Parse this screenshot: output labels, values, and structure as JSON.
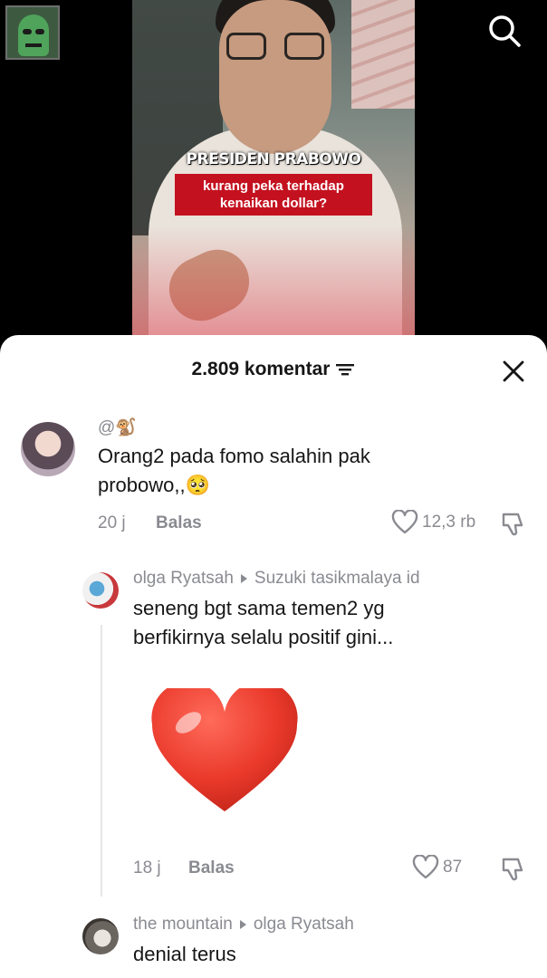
{
  "video": {
    "caption_title": "PRESIDEN PRABOWO",
    "caption_box": "kurang peka terhadap kenaikan dollar?",
    "search_icon": "search-icon"
  },
  "comments_panel": {
    "count_label": "2.809 komentar",
    "filter_icon": "filter-icon",
    "close_icon": "close-icon"
  },
  "comments": [
    {
      "username": "@🐒",
      "text": "Orang2 pada fomo salahin pak probowo,,🥺",
      "time": "20 j",
      "reply_label": "Balas",
      "likes": "12,3 rb"
    },
    {
      "username": "olga Ryatsah",
      "reply_to": "Suzuki tasikmalaya id",
      "text": "seneng bgt sama temen2 yg berfikirnya selalu positif gini...",
      "sticker": "❤️",
      "time": "18 j",
      "reply_label": "Balas",
      "likes": "87"
    },
    {
      "username": "the mountain",
      "reply_to": "olga Ryatsah",
      "text": "denial terus"
    }
  ]
}
